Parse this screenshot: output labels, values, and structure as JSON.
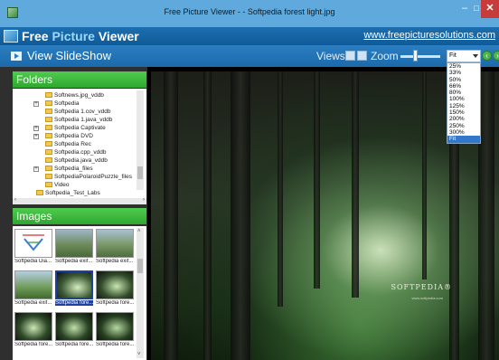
{
  "window": {
    "title": "Free Picture Viewer - - Softpedia forest light.jpg",
    "min_label": "–",
    "max_label": "□",
    "close_label": "✕"
  },
  "header": {
    "logo_part1": "Free ",
    "logo_part2": "Picture",
    "logo_part3": " Viewer",
    "site_link": "www.freepicturesolutions.com"
  },
  "toolbar": {
    "slideshow_label": "View SlideShow",
    "views_label": "Views",
    "zoom_label": "Zoom",
    "zoom_value": "Fit",
    "zoom_options": [
      "25%",
      "33%",
      "50%",
      "66%",
      "80%",
      "100%",
      "125%",
      "150%",
      "200%",
      "250%",
      "300%",
      "Fit"
    ],
    "zoom_selected": "Fit"
  },
  "folders": {
    "header": "Folders",
    "items": [
      {
        "label": "Softnews.jpg_vddb",
        "expander": ""
      },
      {
        "label": "Softpedia",
        "expander": "+"
      },
      {
        "label": "Softpedia 1.cov_vddb",
        "expander": ""
      },
      {
        "label": "Softpedia 1.java_vddb",
        "expander": ""
      },
      {
        "label": "Softpedia Captivate",
        "expander": "+"
      },
      {
        "label": "Softpedia DVD",
        "expander": "+"
      },
      {
        "label": "Softpedia Rec",
        "expander": ""
      },
      {
        "label": "Softpedia.cpp_vddb",
        "expander": ""
      },
      {
        "label": "Softpedia.java_vddb",
        "expander": ""
      },
      {
        "label": "Softpedia_files",
        "expander": "+"
      },
      {
        "label": "SoftpediaPolaroidPuzzle_files",
        "expander": ""
      },
      {
        "label": "Video",
        "expander": ""
      },
      {
        "label": "Softpedia_Test_Labs",
        "expander": ""
      }
    ]
  },
  "images": {
    "header": "Images",
    "thumbs": [
      {
        "label": "Softpedia Dia...",
        "selected": false
      },
      {
        "label": "Softpedia exif...",
        "selected": false
      },
      {
        "label": "Softpedia exif...",
        "selected": false
      },
      {
        "label": "Softpedia exif...",
        "selected": false
      },
      {
        "label": "Softpedia fore...",
        "selected": true
      },
      {
        "label": "Softpedia fore...",
        "selected": false
      },
      {
        "label": "Softpedia fore...",
        "selected": false
      },
      {
        "label": "Softpedia fore...",
        "selected": false
      },
      {
        "label": "Softpedia fore...",
        "selected": false
      }
    ]
  },
  "viewer": {
    "watermark": "SOFTPEDIA",
    "watermark_mark": "®",
    "watermark_sub": "www.softpedia.com"
  }
}
